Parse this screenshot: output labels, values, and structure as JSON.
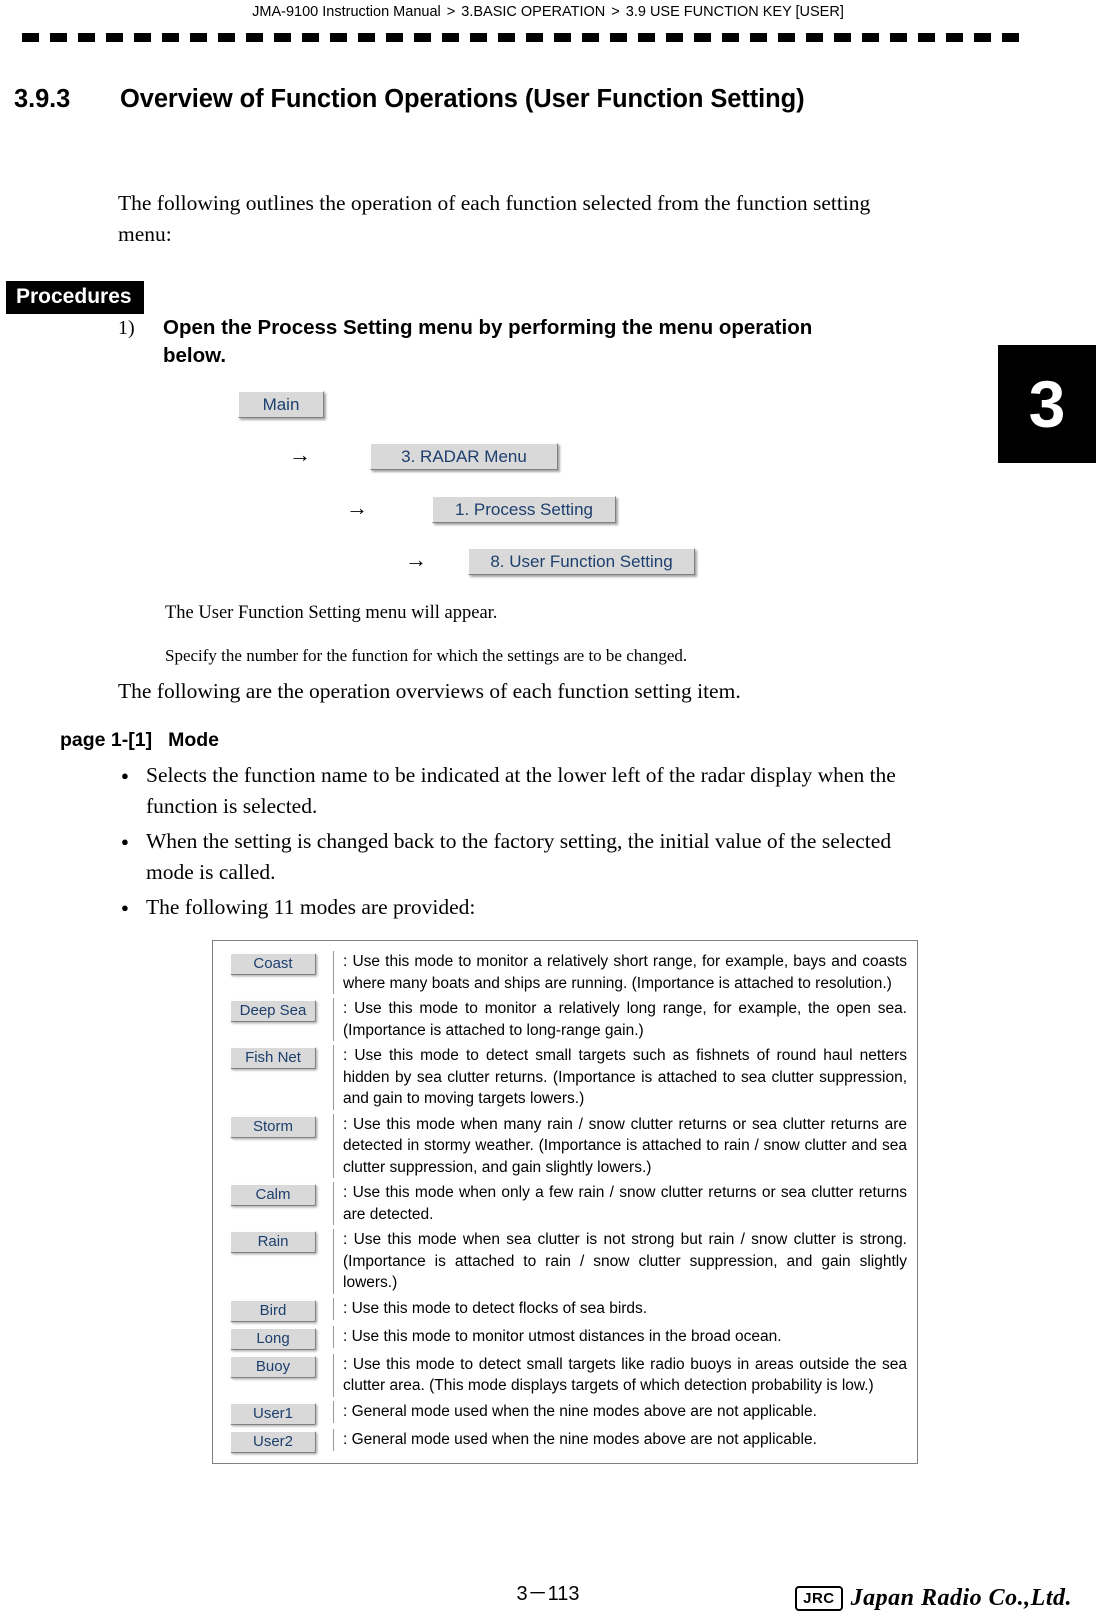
{
  "header": {
    "manual": "JMA-9100 Instruction Manual",
    "sep1": ">",
    "chapter": "3.BASIC OPERATION",
    "sep2": ">",
    "section": "3.9  USE FUNCTION KEY [USER]"
  },
  "chapter_tab": "3",
  "section_heading": {
    "number": "3.9.3",
    "title": "Overview of Function Operations (User Function Setting)"
  },
  "intro_paragraph": "The following outlines the operation of each function selected from the function setting menu:",
  "procedures_label": "Procedures",
  "step": {
    "number": "1)",
    "text": "Open the Process Setting menu by performing the menu operation below."
  },
  "menu_chain": {
    "arrow": "→",
    "items": [
      "Main",
      "3. RADAR Menu",
      "1. Process Setting",
      "8. User Function Setting"
    ]
  },
  "after_chain": {
    "line1": "The User Function Setting menu will appear.",
    "line2": "Specify the number for the function for which the settings are to be changed."
  },
  "overview_paragraph": "The following are the operation overviews of each function setting item.",
  "subheading": {
    "page": "page 1-[1]",
    "title": "Mode"
  },
  "bullets": [
    "Selects the function name to be indicated at the lower left of the radar display when the function is selected.",
    "When the setting is changed back to the factory setting, the initial value of the selected mode is called.",
    "The following 11 modes are provided:"
  ],
  "mode_table": [
    {
      "button": "Coast",
      "desc": ": Use this mode to monitor a relatively short range, for example, bays and coasts where many boats and ships are running. (Importance is attached to resolution.)"
    },
    {
      "button": "Deep Sea",
      "desc": ": Use this mode to monitor a relatively long range, for example, the open sea. (Importance is attached to long-range gain.)"
    },
    {
      "button": "Fish Net",
      "desc": ": Use this mode to detect small targets such as fishnets of round haul netters hidden by sea clutter returns. (Importance is attached to sea clutter suppression, and gain to moving targets lowers.)"
    },
    {
      "button": "Storm",
      "desc": ": Use this mode when many rain / snow clutter returns or sea clutter returns are detected in stormy weather. (Importance is attached to rain / snow clutter and sea clutter suppression, and gain slightly lowers.)"
    },
    {
      "button": "Calm",
      "desc": ": Use this mode when only a few rain / snow clutter returns or sea clutter returns are detected."
    },
    {
      "button": "Rain",
      "desc": ": Use this mode when sea clutter is not strong but rain / snow clutter is strong. (Importance is attached to rain / snow clutter suppression, and gain slightly lowers.)"
    },
    {
      "button": "Bird",
      "desc": ": Use this mode to detect flocks of sea birds."
    },
    {
      "button": "Long",
      "desc": ": Use this mode to monitor utmost distances in the broad ocean."
    },
    {
      "button": "Buoy",
      "desc": ": Use this mode to detect small targets like radio buoys in areas outside the sea clutter area. (This mode displays targets of which detection probability is low.)"
    },
    {
      "button": "User1",
      "desc": ": General mode used when the nine modes above are not applicable."
    },
    {
      "button": "User2",
      "desc": ": General mode used when the nine modes above are not applicable."
    }
  ],
  "footer": {
    "page_number": "3－113",
    "logo_badge": "JRC",
    "logo_name": "Japan Radio Co.,Ltd."
  }
}
